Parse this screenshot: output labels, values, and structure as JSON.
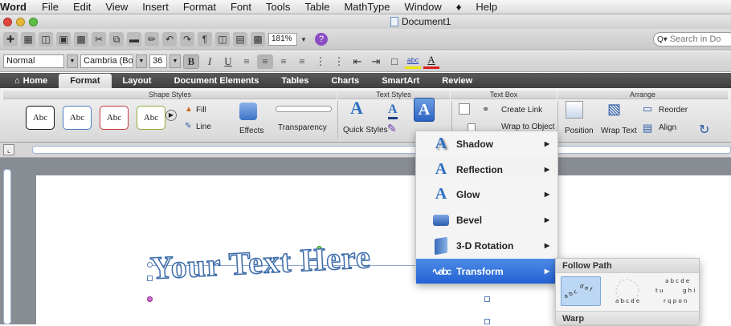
{
  "menubar": {
    "app": "Word",
    "items": [
      "File",
      "Edit",
      "View",
      "Insert",
      "Format",
      "Font",
      "Tools",
      "Table",
      "MathType",
      "Window",
      "Help"
    ]
  },
  "window": {
    "title": "Document1"
  },
  "toolbar": {
    "zoom": "181%",
    "search_placeholder": "Search in Do"
  },
  "format_bar": {
    "style": "Normal",
    "font": "Cambria (Bo...",
    "size": "36"
  },
  "ribbon_tabs": [
    "Home",
    "Format",
    "Layout",
    "Document Elements",
    "Tables",
    "Charts",
    "SmartArt",
    "Review"
  ],
  "ribbon": {
    "groups": {
      "shape_styles": "Shape Styles",
      "text_styles": "Text Styles",
      "text_box": "Text Box",
      "arrange": "Arrange"
    },
    "abc": "Abc",
    "fill": "Fill",
    "line": "Line",
    "effects": "Effects",
    "transparency": "Transparency",
    "quick_styles": "Quick Styles",
    "create_link": "Create Link",
    "wrap_to_object": "Wrap to Object",
    "position": "Position",
    "wrap_text": "Wrap Text",
    "reorder": "Reorder",
    "align": "Align"
  },
  "document": {
    "wordart_text": "Your Text Here"
  },
  "effects_menu": {
    "items": [
      "Shadow",
      "Reflection",
      "Glow",
      "Bevel",
      "3-D Rotation",
      "Transform"
    ],
    "highlighted": "Transform"
  },
  "transform_submenu": {
    "header": "Follow Path",
    "warp_header": "Warp"
  },
  "colors": {
    "accent": "#2462d4",
    "wordart_outline": "#3a6aa8"
  }
}
